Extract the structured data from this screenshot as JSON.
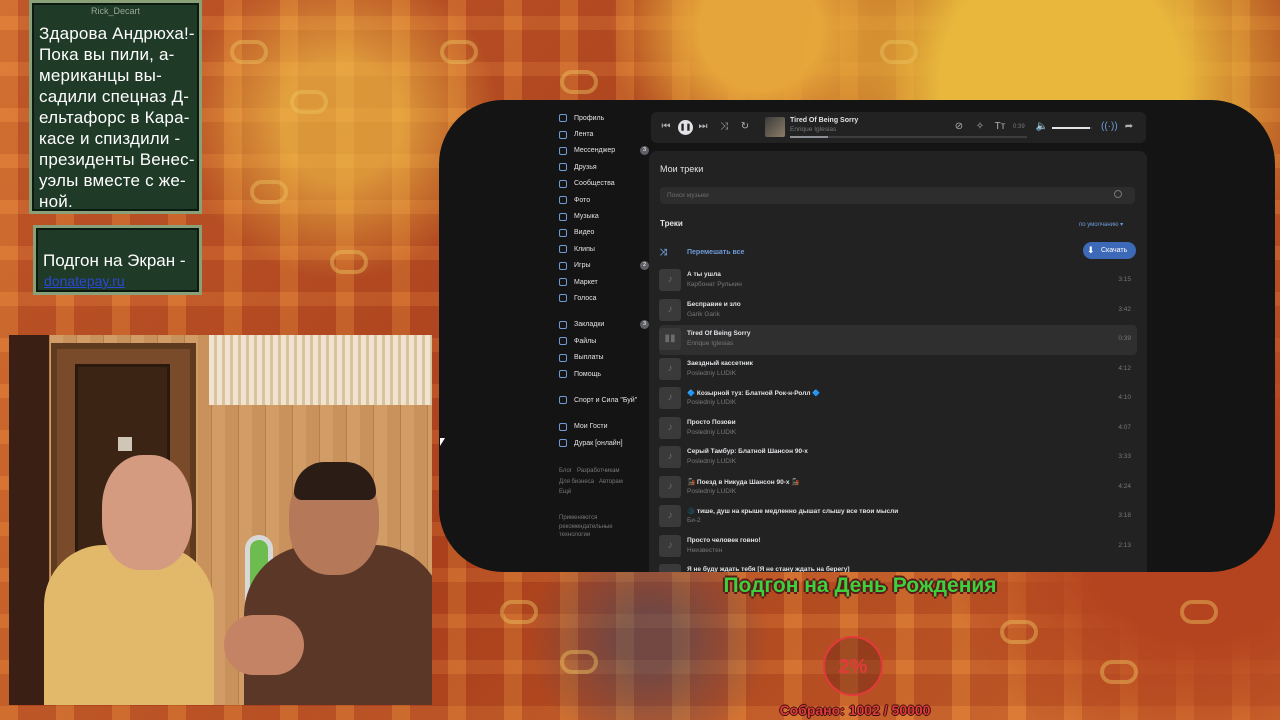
{
  "overlay": {
    "news": {
      "author": "Rick_Decart",
      "text": "Здарова Андрюха!- Пока вы пили, а-мериканцы вы-садили спецназ Д-ельтафорс в Кара-касе и спиздили - президенты Венес-уэлы вместе с же-ной."
    },
    "promo": {
      "title": "Подгон на Экран -",
      "link": "donatepay.ru"
    },
    "goal": {
      "title": "Подгон на День Рождения",
      "percent": "2%",
      "progress": 0.02,
      "collected": "Собрано: 1002 / 50000"
    }
  },
  "sidebar": {
    "items": [
      {
        "label": "Профиль",
        "icon": "user-icon"
      },
      {
        "label": "Лента",
        "icon": "feed-icon"
      },
      {
        "label": "Мессенджер",
        "icon": "chat-icon",
        "badge": "3"
      },
      {
        "label": "Друзья",
        "icon": "friends-icon"
      },
      {
        "label": "Сообщества",
        "icon": "groups-icon"
      },
      {
        "label": "Фото",
        "icon": "photo-icon"
      },
      {
        "label": "Музыка",
        "icon": "music-icon"
      },
      {
        "label": "Видео",
        "icon": "video-icon"
      },
      {
        "label": "Клипы",
        "icon": "clips-icon"
      },
      {
        "label": "Игры",
        "icon": "games-icon",
        "badge": "2"
      },
      {
        "label": "Маркет",
        "icon": "market-icon"
      },
      {
        "label": "Голоса",
        "icon": "votes-icon"
      },
      {
        "label": "Закладки",
        "icon": "bookmark-icon",
        "badge": "3"
      },
      {
        "label": "Файлы",
        "icon": "files-icon"
      },
      {
        "label": "Выплаты",
        "icon": "payouts-icon"
      },
      {
        "label": "Помощь",
        "icon": "help-icon"
      },
      {
        "label": "Спорт и Сила \"Буй\"",
        "icon": "community-icon"
      },
      {
        "label": "Мои Гости",
        "icon": "guests-icon"
      },
      {
        "label": "Дурак [онлайн]",
        "icon": "game-app-icon"
      }
    ],
    "footer": {
      "links": [
        "Блог",
        "Разработчикам",
        "Для бизнеса",
        "Авторам",
        "Ещё"
      ],
      "note": "Применяются рекомендательные технологии"
    }
  },
  "player": {
    "title": "Tired Of Being Sorry",
    "artist": "Enrique Iglesias",
    "time": "0:39",
    "progress": 0.16,
    "volume": 0.95
  },
  "music": {
    "page_title": "Мои треки",
    "search_placeholder": "Поиск музыки",
    "tracks_label": "Треки",
    "sort": "по умолчанию",
    "shuffle_all": "Перемешать все",
    "download": "Скачать",
    "tracks": [
      {
        "title": "А ты ушла",
        "artist": "Карбонат Рулькин",
        "duration": "3:15"
      },
      {
        "title": "Бесправие и зло",
        "artist": "Garik Garik",
        "duration": "3:42"
      },
      {
        "title": "Tired Of Being Sorry",
        "artist": "Enrique Iglesias",
        "duration": "0:39",
        "active": true
      },
      {
        "title": "Заездный кассетник",
        "artist": "Posledniy LUDIK",
        "duration": "4:12"
      },
      {
        "title": "🔷 Козырной туз: Блатной Рок-н-Ролл 🔷",
        "artist": "Posledniy LUDIK",
        "duration": "4:10"
      },
      {
        "title": "Просто Позови",
        "artist": "Posledniy LUDIK",
        "duration": "4:07"
      },
      {
        "title": "Серый Тамбур: Блатной Шансон 90-х",
        "artist": "Posledniy LUDIK",
        "duration": "3:33"
      },
      {
        "title": "🚂 Поезд в Никуда Шансон 90-х 🚂",
        "artist": "Posledniy LUDIK",
        "duration": "4:24"
      },
      {
        "title": "🌑 тише, душ на крыше медленно дышат слышу все твои мысли",
        "artist": "Би-2",
        "duration": "3:18"
      },
      {
        "title": "Просто человек говно!",
        "artist": "Неизвестен",
        "duration": "2:13"
      },
      {
        "title": "Я не буду ждать тебя [Я не стану ждать на берегу]",
        "artist": "",
        "duration": ""
      }
    ]
  }
}
